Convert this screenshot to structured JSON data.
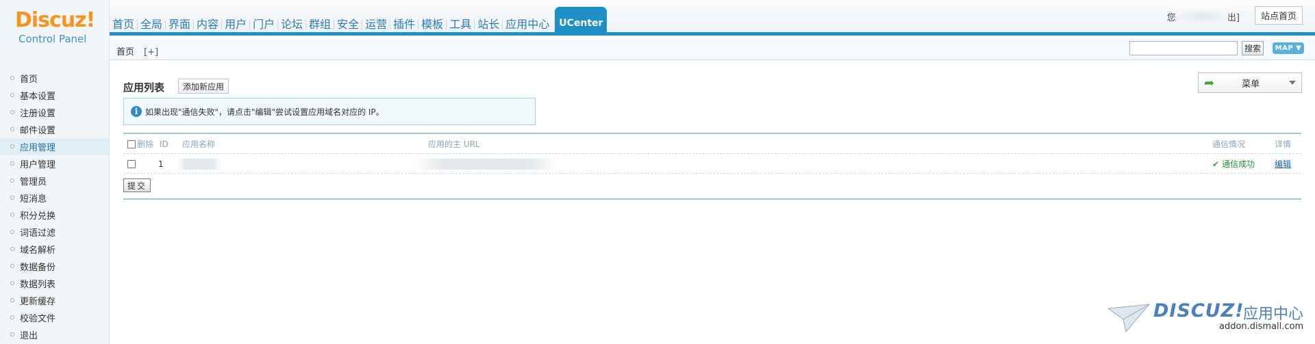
{
  "logo": {
    "brand": "Discuz!",
    "subtitle": "Control Panel"
  },
  "topnav": {
    "items": [
      "首页",
      "全局",
      "界面",
      "内容",
      "用户",
      "门户",
      "论坛",
      "群组",
      "安全",
      "运营",
      "插件",
      "模板",
      "工具",
      "站长",
      "应用中心"
    ],
    "active": "UCenter"
  },
  "user": {
    "logout_suffix": "出]",
    "site_home": "站点首页",
    "name_first_char": "您"
  },
  "subbar": {
    "breadcrumb": "首页",
    "add": "[+]",
    "search_label": "搜索",
    "map_label": "MAP"
  },
  "sidebar": {
    "items": [
      "首页",
      "基本设置",
      "注册设置",
      "邮件设置",
      "应用管理",
      "用户管理",
      "管理员",
      "短消息",
      "积分兑换",
      "词语过滤",
      "域名解析",
      "数据备份",
      "数据列表",
      "更新缓存",
      "校验文件",
      "退出"
    ],
    "active_index": 4
  },
  "main": {
    "title": "应用列表",
    "add_app": "添加新应用",
    "info": "如果出现\"通信失败\"，请点击\"编辑\"尝试设置应用域名对应的 IP。",
    "menu_label": "菜单",
    "table": {
      "headers": {
        "delete": "删除",
        "id": "ID",
        "name": "应用名称",
        "url": "应用的主 URL",
        "status": "通信情况",
        "detail": "详情"
      },
      "rows": [
        {
          "id": "1",
          "status": "通信成功",
          "edit": "编辑"
        }
      ]
    },
    "submit": "提交"
  },
  "watermark": {
    "logo": "DISCUZ!",
    "cn": "应用中心",
    "url": "addon.dismall.com"
  },
  "colors": {
    "accent": "#1f8fc4",
    "brand_orange": "#f7941d",
    "success": "#2d8a2d"
  }
}
